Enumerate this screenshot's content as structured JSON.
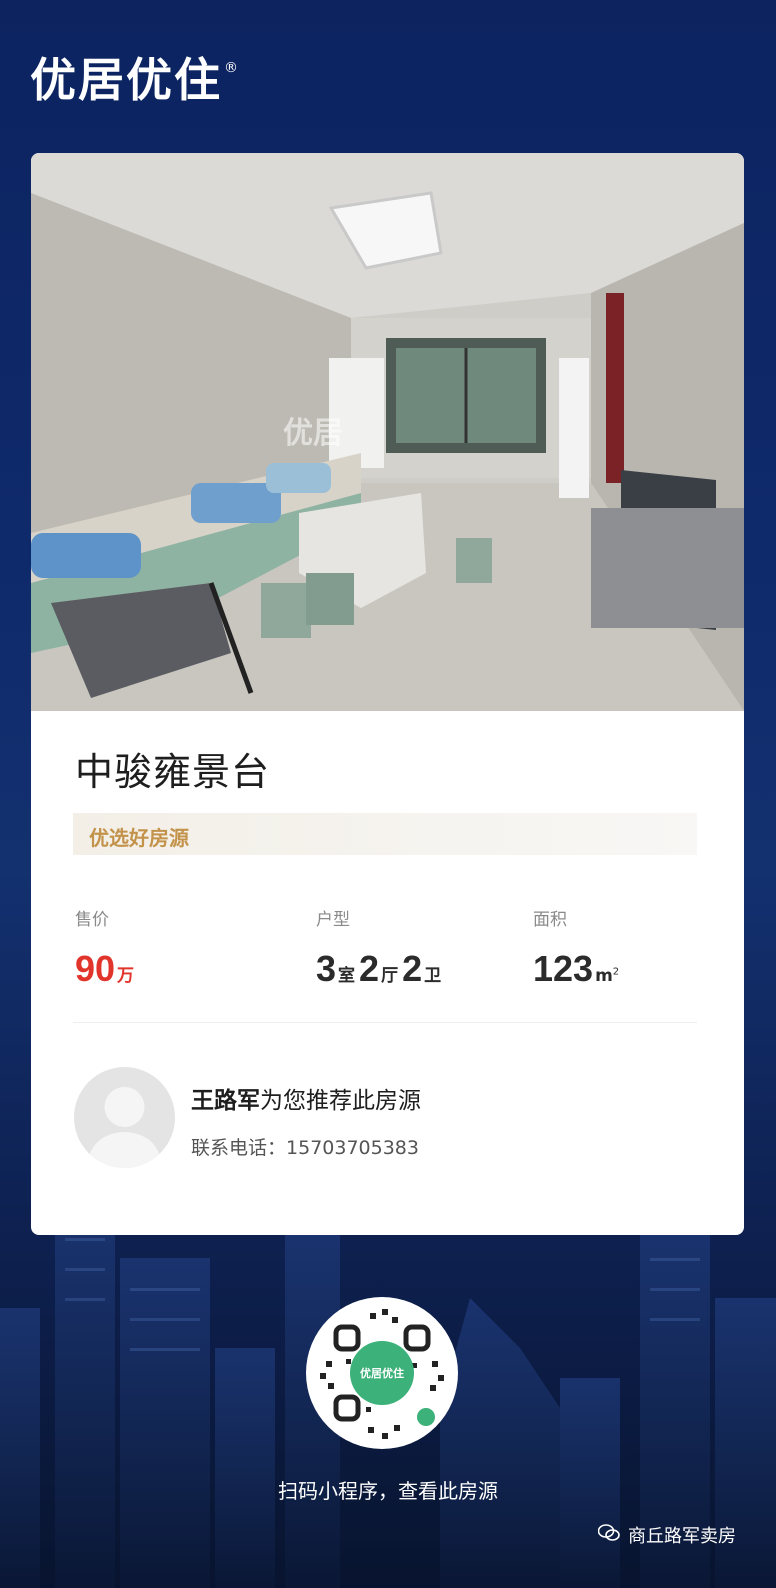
{
  "brand": {
    "logo_text": "优居优住",
    "registered_mark": "®"
  },
  "listing": {
    "watermark": "优居",
    "title": "中骏雍景台",
    "tag": "优选好房源",
    "price": {
      "label": "售价",
      "value": "90",
      "unit": "万"
    },
    "layout": {
      "label": "户型",
      "rooms": "3",
      "rooms_unit": "室",
      "halls": "2",
      "halls_unit": "厅",
      "baths": "2",
      "baths_unit": "卫"
    },
    "area": {
      "label": "面积",
      "value": "123",
      "unit": "m",
      "unit_sup": "2"
    }
  },
  "agent": {
    "name": "王路军",
    "recommend_text": "为您推荐此房源",
    "phone_label": "联系电话：",
    "phone": "15703705383"
  },
  "qr": {
    "center_text": "优居优住"
  },
  "footer": {
    "scan_text": "扫码小程序，查看此房源",
    "account_name": "商丘路军卖房"
  }
}
